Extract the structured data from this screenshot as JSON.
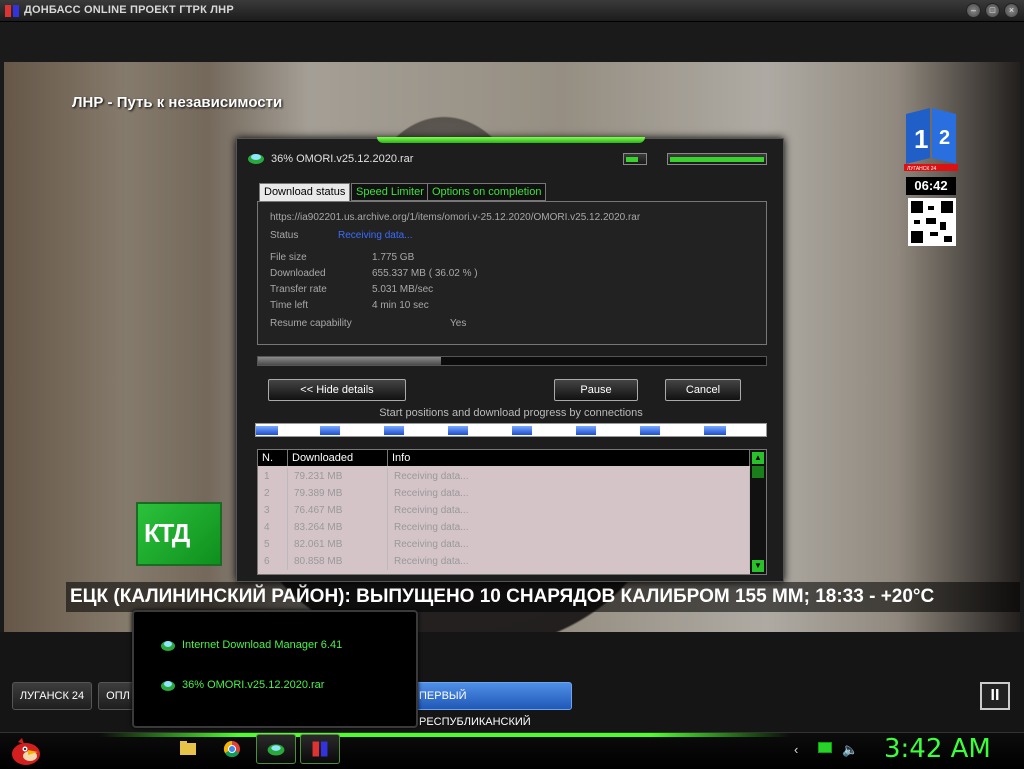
{
  "app": {
    "title": "ДОНБАСС ONLINE ПРОЕКТ ГТРК ЛНР"
  },
  "video": {
    "channel_title": "ЛНР - Путь к независимости",
    "logo_digit": "1",
    "logo_small_text": "ЛУГАНСК 24",
    "clock": "06:42",
    "ktd_logo": "КТД",
    "ticker": "ЕЦК (КАЛИНИНСКИЙ РАЙОН): ВЫПУЩЕНО 10 СНАРЯДОВ КАЛИБРОМ 155 ММ; 18:33 - +20°С"
  },
  "channels": {
    "btn1": "ЛУГАНСК 24",
    "btn2": "ОПЛ",
    "btn_active": "ПЕРВЫЙ РЕСПУБЛИКАНСКИЙ"
  },
  "taskbar_popup": {
    "items": [
      "Internet Download Manager 6.41",
      "36% OMORI.v25.12.2020.rar"
    ]
  },
  "download_dialog": {
    "title": "36% OMORI.v25.12.2020.rar",
    "tabs": [
      "Download status",
      "Speed Limiter",
      "Options on completion"
    ],
    "url": "https://ia902201.us.archive.org/1/items/omori.v-25.12.2020/OMORI.v25.12.2020.rar",
    "status_label": "Status",
    "status_value": "Receiving data...",
    "fields": [
      {
        "label": "File size",
        "value": "1.775  GB"
      },
      {
        "label": "Downloaded",
        "value": "655.337  MB  ( 36.02 % )"
      },
      {
        "label": "Transfer rate",
        "value": "5.031  MB/sec"
      },
      {
        "label": "Time left",
        "value": "4 min 10 sec"
      },
      {
        "label": "Resume capability",
        "value": "Yes"
      }
    ],
    "progress": 0.36,
    "buttons": {
      "hide_details": "<< Hide details",
      "pause": "Pause",
      "cancel": "Cancel"
    },
    "connections_label": "Start positions and download progress by connections",
    "table": {
      "headers": [
        "N.",
        "Downloaded",
        "Info"
      ],
      "rows": [
        [
          "1",
          "79.231  MB",
          "Receiving data..."
        ],
        [
          "2",
          "79.389  MB",
          "Receiving data..."
        ],
        [
          "3",
          "76.467  MB",
          "Receiving data..."
        ],
        [
          "4",
          "83.264  MB",
          "Receiving data..."
        ],
        [
          "5",
          "82.061  MB",
          "Receiving data..."
        ],
        [
          "6",
          "80.858  MB",
          "Receiving data..."
        ]
      ]
    }
  },
  "system": {
    "clock": "3:42 AM"
  }
}
